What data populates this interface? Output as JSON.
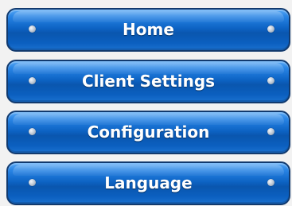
{
  "nav": {
    "items": [
      {
        "label": "Home",
        "icon_left": "rivet-icon",
        "icon_right": "rivet-icon"
      },
      {
        "label": "Client Settings",
        "icon_left": "rivet-icon",
        "icon_right": "rivet-icon"
      },
      {
        "label": "Configuration",
        "icon_left": "rivet-icon",
        "icon_right": "rivet-icon"
      },
      {
        "label": "Language",
        "icon_left": "rivet-icon",
        "icon_right": "rivet-icon"
      }
    ]
  },
  "colors": {
    "button_blue": "#0d63c4",
    "button_border": "#123a6e",
    "label_text": "#ffffff",
    "background": "#f2f2f2"
  }
}
